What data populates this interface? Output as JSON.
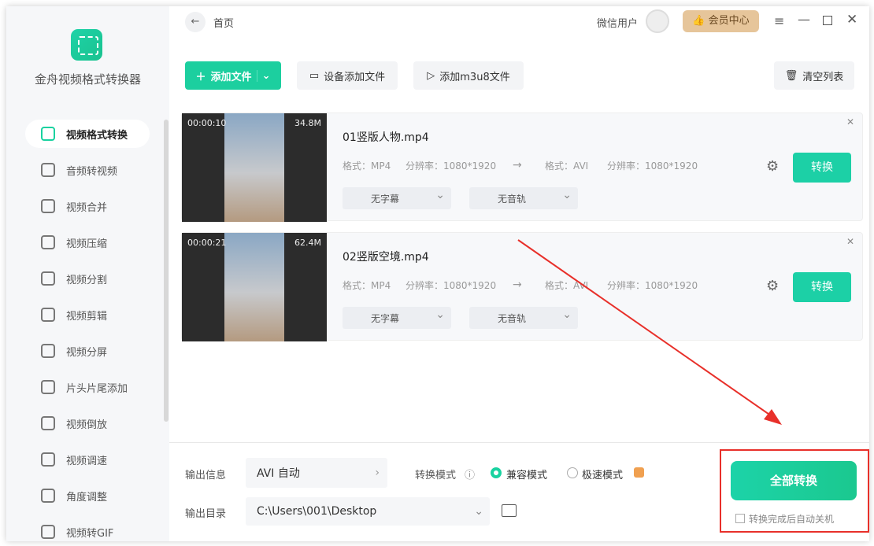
{
  "app": {
    "name": "金舟视频格式转换器"
  },
  "sidebar": {
    "items": [
      {
        "label": "视频格式转换",
        "active": true
      },
      {
        "label": "音频转视频"
      },
      {
        "label": "视频合并"
      },
      {
        "label": "视频压缩"
      },
      {
        "label": "视频分割"
      },
      {
        "label": "视频剪辑"
      },
      {
        "label": "视频分屏"
      },
      {
        "label": "片头片尾添加"
      },
      {
        "label": "视频倒放"
      },
      {
        "label": "视频调速"
      },
      {
        "label": "角度调整"
      },
      {
        "label": "视频转GIF"
      }
    ]
  },
  "header": {
    "breadcrumb": "首页",
    "user": "微信用户",
    "vip": "会员中心"
  },
  "toolbar": {
    "add_file": "添加文件",
    "device_add": "设备添加文件",
    "add_m3u8": "添加m3u8文件",
    "clear": "清空列表"
  },
  "files": [
    {
      "name": "01竖版人物.mp4",
      "duration": "00:00:10",
      "size": "34.8M",
      "src_format": "格式：MP4",
      "src_res": "分辨率：1080*1920",
      "dst_format": "格式：AVI",
      "dst_res": "分辨率：1080*1920",
      "subtitle": "无字幕",
      "audio": "无音轨",
      "convert": "转换"
    },
    {
      "name": "02竖版空境.mp4",
      "duration": "00:00:21",
      "size": "62.4M",
      "src_format": "格式：MP4",
      "src_res": "分辨率：1080*1920",
      "dst_format": "格式：AVI",
      "dst_res": "分辨率：1080*1920",
      "subtitle": "无字幕",
      "audio": "无音轨",
      "convert": "转换"
    }
  ],
  "bottom": {
    "output_info_label": "输出信息",
    "output_info": "AVI 自动",
    "mode_label": "转换模式",
    "mode_compat": "兼容模式",
    "mode_fast": "极速模式",
    "output_dir_label": "输出目录",
    "output_dir": "C:\\Users\\001\\Desktop",
    "convert_all": "全部转换",
    "auto_shutdown": "转换完成后自动关机"
  }
}
